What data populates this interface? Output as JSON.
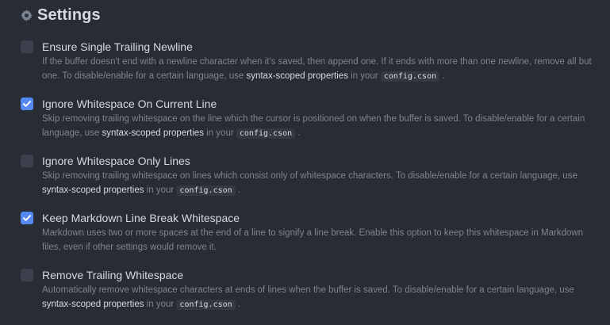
{
  "header": {
    "title": "Settings",
    "icon": "gear-icon"
  },
  "colors": {
    "accent": "#568af2",
    "background": "#282c34",
    "checkbox_off": "#3a3f4b"
  },
  "settings": [
    {
      "label": "Ensure Single Trailing Newline",
      "checked": false,
      "desc_text": "If the buffer doesn't end with a newline character when it's saved, then append one. If it ends with more than one newline, remove all but one. To disable/enable for a certain language, use",
      "link": "syntax-scoped properties",
      "in_your": "in your",
      "code": "config.cson",
      "end": "."
    },
    {
      "label": "Ignore Whitespace On Current Line",
      "checked": true,
      "desc_text": "Skip removing trailing whitespace on the line which the cursor is positioned on when the buffer is saved. To disable/enable for a certain language, use",
      "link": "syntax-scoped properties",
      "in_your": "in your",
      "code": "config.cson",
      "end": "."
    },
    {
      "label": "Ignore Whitespace Only Lines",
      "checked": false,
      "desc_text": "Skip removing trailing whitespace on lines which consist only of whitespace characters. To disable/enable for a certain language, use",
      "link": "syntax-scoped properties",
      "in_your": "in your",
      "code": "config.cson",
      "end": "."
    },
    {
      "label": "Keep Markdown Line Break Whitespace",
      "checked": true,
      "desc_text": "Markdown uses two or more spaces at the end of a line to signify a line break. Enable this option to keep this whitespace in Markdown files, even if other settings would remove it."
    },
    {
      "label": "Remove Trailing Whitespace",
      "checked": false,
      "desc_text": "Automatically remove whitespace characters at ends of lines when the buffer is saved. To disable/enable for a certain language, use",
      "link": "syntax-scoped properties",
      "in_your": "in your",
      "code": "config.cson",
      "end": "."
    }
  ]
}
